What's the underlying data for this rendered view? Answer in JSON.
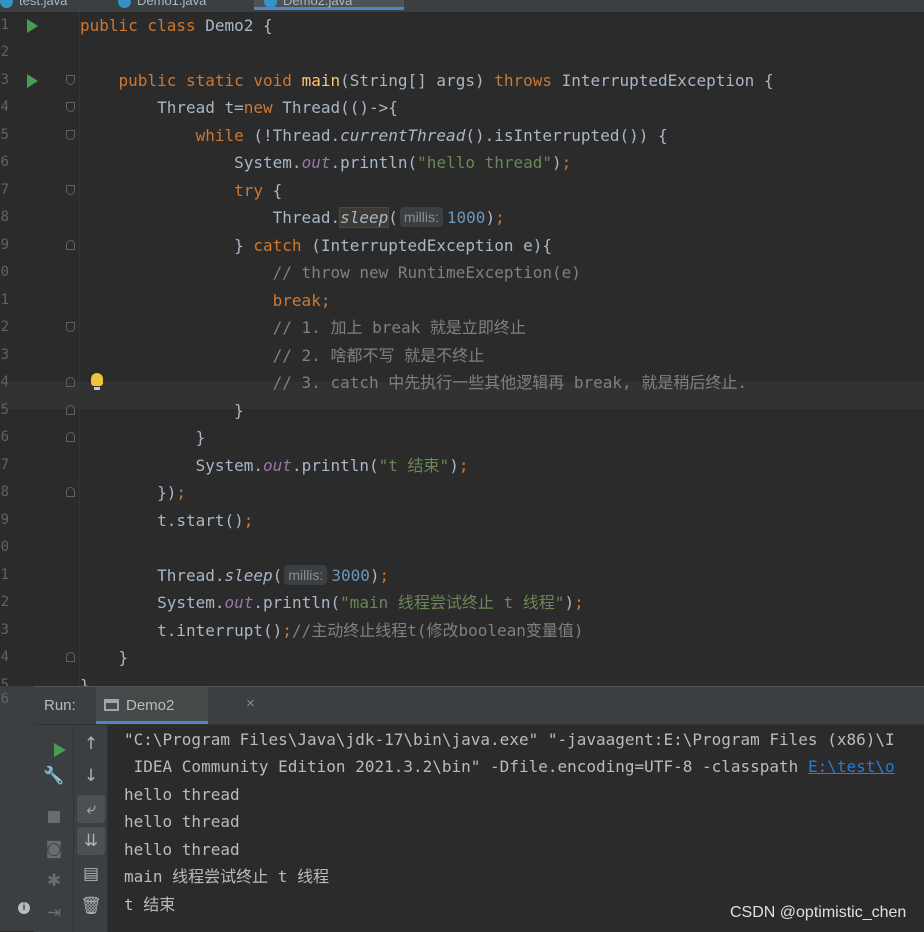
{
  "tabs": [
    {
      "label": "test.java",
      "active": false
    },
    {
      "label": "Demo1.java",
      "active": false
    },
    {
      "label": "Demo2.java",
      "active": true
    }
  ],
  "editor": {
    "line_numbers": [
      "1",
      "2",
      "3",
      "4",
      "5",
      "6",
      "7",
      "8",
      "9",
      "0",
      "1",
      "2",
      "3",
      "4",
      "5",
      "6",
      "7",
      "8",
      "9",
      "0",
      "1",
      "2",
      "3",
      "4",
      "5",
      "6"
    ],
    "hints": {
      "millis_label": "millis:"
    },
    "strings": {
      "hello": "\"hello thread\"",
      "t_end": "\"t 结束\"",
      "main_msg": "\"main 线程尝试终止 t 线程\""
    },
    "numbers": {
      "sleep1": "1000",
      "sleep2": "3000"
    },
    "comments": {
      "c1": "// throw new RuntimeException(e)",
      "c2": "// 1. 加上 break 就是立即终止",
      "c3": "// 2. 啥都不写 就是不终止",
      "c4": "// 3. catch 中先执行一些其他逻辑再 break, 就是稍后终止.",
      "c5": "//主动终止线程t(修改boolean变量值)"
    }
  },
  "run": {
    "label": "Run:",
    "tab_label": "Demo2",
    "tab_close": "×",
    "output": [
      "\"C:\\Program Files\\Java\\jdk-17\\bin\\java.exe\" \"-javaagent:E:\\Program Files (x86)\\I",
      " IDEA Community Edition 2021.3.2\\bin\" -Dfile.encoding=UTF-8 -classpath ",
      "hello thread",
      "hello thread",
      "hello thread",
      "main 线程尝试终止 t 线程",
      "t 结束"
    ],
    "classpath_link": "E:\\test\\o"
  },
  "watermark": "CSDN @optimistic_chen",
  "icons": [
    "run-gutter-icon",
    "fold-marker-icon",
    "lightbulb-icon",
    "rerun-icon",
    "wrench-icon",
    "stop-icon",
    "camera-icon",
    "bug-icon",
    "login-icon",
    "up-arrow-icon",
    "down-arrow-icon",
    "soft-wrap-icon",
    "scroll-to-end-icon",
    "print-icon",
    "trash-icon",
    "info-icon"
  ],
  "colors": {
    "background": "#2b2b2b",
    "keyword": "#cc7832",
    "string": "#6a8759",
    "number": "#6897bb",
    "comment": "#808080",
    "field": "#9876aa",
    "method": "#ffc66d",
    "run_green": "#499c54",
    "link": "#287bde"
  }
}
